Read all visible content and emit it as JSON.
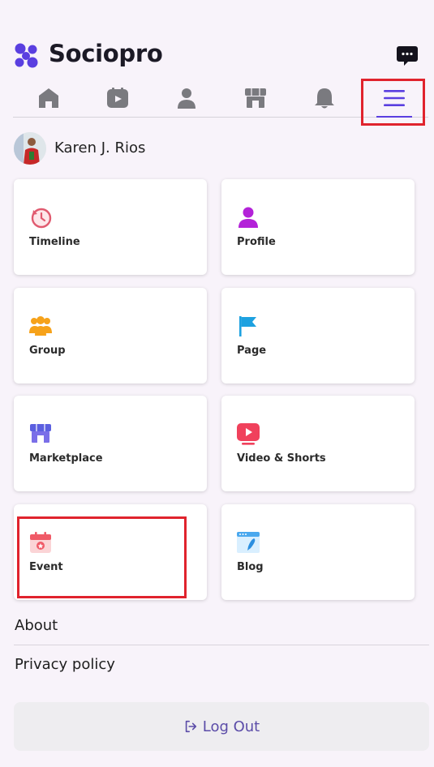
{
  "app": {
    "brand": "Sociopro"
  },
  "header": {
    "messages_icon": "chat-bubble-icon"
  },
  "tabs": [
    {
      "name": "home",
      "icon": "home-icon"
    },
    {
      "name": "videos",
      "icon": "video-icon"
    },
    {
      "name": "profile",
      "icon": "user-icon"
    },
    {
      "name": "marketplace",
      "icon": "store-icon"
    },
    {
      "name": "notifications",
      "icon": "bell-icon"
    },
    {
      "name": "menu",
      "icon": "menu-icon",
      "active": true
    }
  ],
  "user": {
    "name": "Karen J. Rios"
  },
  "menu_cards": [
    {
      "label": "Timeline",
      "icon": "history-icon"
    },
    {
      "label": "Profile",
      "icon": "profile-icon"
    },
    {
      "label": "Group",
      "icon": "group-icon"
    },
    {
      "label": "Page",
      "icon": "flag-icon"
    },
    {
      "label": "Marketplace",
      "icon": "store-icon"
    },
    {
      "label": "Video & Shorts",
      "icon": "video-play-icon"
    },
    {
      "label": "Event",
      "icon": "calendar-icon"
    },
    {
      "label": "Blog",
      "icon": "blog-icon"
    }
  ],
  "links": {
    "about": "About",
    "privacy": "Privacy policy"
  },
  "logout": {
    "label": "Log Out"
  },
  "colors": {
    "accent": "#5a3fe0",
    "highlight": "#e0232d",
    "brand_dark": "#1c1a26"
  }
}
